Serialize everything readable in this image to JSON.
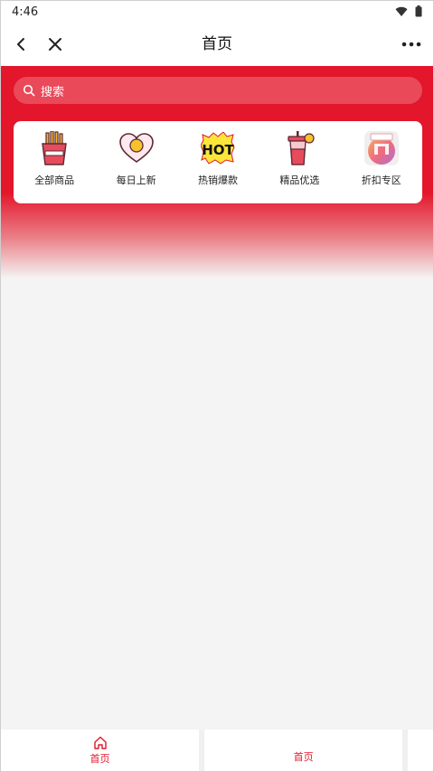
{
  "status_bar": {
    "time": "4:46"
  },
  "nav": {
    "title": "首页"
  },
  "search": {
    "placeholder": "搜索"
  },
  "categories": [
    {
      "label": "全部商品",
      "icon": "fries-icon"
    },
    {
      "label": "每日上新",
      "icon": "heart-egg-icon"
    },
    {
      "label": "热销爆款",
      "icon": "hot-icon"
    },
    {
      "label": "精品优选",
      "icon": "drink-cup-icon"
    },
    {
      "label": "折扣专区",
      "icon": "discount-shop-icon"
    }
  ],
  "tabs": [
    {
      "label": "首页",
      "icon": "home-icon"
    },
    {
      "label": "首页"
    }
  ],
  "colors": {
    "accent": "#e3162b",
    "background": "#f4f4f4"
  }
}
